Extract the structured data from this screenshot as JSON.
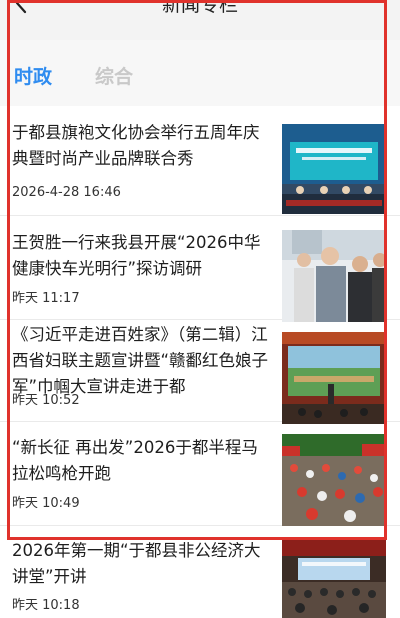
{
  "header": {
    "title": "新闻专栏",
    "back_icon": "chevron-left-icon"
  },
  "tabs": [
    {
      "label": "时政",
      "active": true
    },
    {
      "label": "综合",
      "active": false
    }
  ],
  "news": [
    {
      "title": "于都县旗袍文化协会举行五周年庆典暨时尚产业品牌联合秀",
      "time": "2026-4-28 16:46",
      "thumb": "conference-stage-image"
    },
    {
      "title": "王贺胜一行来我县开展“2026中华健康快车光明行”探访调研",
      "time": "昨天 11:17",
      "thumb": "officials-visit-image"
    },
    {
      "title": "《习近平走进百姓家》（第二辑）江西省妇联主题宣讲暨“赣鄱红色娘子军”巾帼大宣讲走进于都",
      "time": "昨天 10:52",
      "thumb": "lecture-hall-image"
    },
    {
      "title": "“新长征 再出发”2026于都半程马拉松鸣枪开跑",
      "time": "昨天 10:49",
      "thumb": "marathon-crowd-image"
    },
    {
      "title": "2026年第一期“于都县非公经济大讲堂”开讲",
      "time": "昨天 10:18",
      "thumb": "auditorium-image"
    }
  ],
  "colors": {
    "accent": "#2f8cf0",
    "highlight_frame": "#e0322c"
  }
}
